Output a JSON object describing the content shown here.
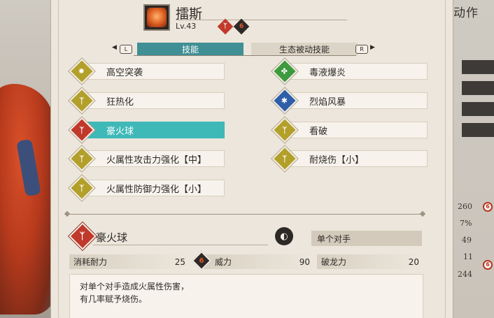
{
  "header": {
    "monster_name": "擂斯",
    "level": "Lv.43",
    "type_icons": [
      {
        "name": "claw-type-icon",
        "glyph": "ᛉ",
        "bg": "#c0392b",
        "fg": "#ffffff"
      },
      {
        "name": "fire-element-icon",
        "glyph": "6",
        "bg": "#2d2926",
        "fg": "#e25a2a"
      }
    ]
  },
  "tabs": {
    "left_key": "L",
    "right_key": "R",
    "items": [
      {
        "label": "技能",
        "active": true
      },
      {
        "label": "生态被动技能",
        "active": false
      }
    ]
  },
  "skills": {
    "left": [
      {
        "label": "高空突袭",
        "icon": "sun-burst-icon",
        "icon_color": "#b3a02a",
        "glyph": "✹",
        "selected": false
      },
      {
        "label": "狂热化",
        "icon": "power-fist-icon",
        "icon_color": "#b3a02a",
        "glyph": "ᛉ",
        "selected": false
      },
      {
        "label": "豪火球",
        "icon": "power-fist-icon",
        "icon_color": "#c0392b",
        "glyph": "ᛉ",
        "selected": true
      },
      {
        "label": "火属性攻击力强化【中】",
        "icon": "power-fist-icon",
        "icon_color": "#b3a02a",
        "glyph": "ᛉ",
        "selected": false
      },
      {
        "label": "火属性防御力强化【小】",
        "icon": "power-fist-icon",
        "icon_color": "#b3a02a",
        "glyph": "ᛉ",
        "selected": false
      }
    ],
    "right": [
      {
        "label": "毒液爆炎",
        "icon": "venom-clover-icon",
        "icon_color": "#3e9a3e",
        "glyph": "✤",
        "selected": false
      },
      {
        "label": "烈焰风暴",
        "icon": "storm-swirl-icon",
        "icon_color": "#2e5fa8",
        "glyph": "✱",
        "selected": false
      },
      {
        "label": "看破",
        "icon": "power-fist-icon",
        "icon_color": "#b3a02a",
        "glyph": "ᛉ",
        "selected": false
      },
      {
        "label": "耐烧伤【小】",
        "icon": "power-fist-icon",
        "icon_color": "#b3a02a",
        "glyph": "ᛉ",
        "selected": false
      }
    ]
  },
  "detail": {
    "name": "豪火球",
    "target": "单个对手",
    "stamina_label": "消耗耐力",
    "stamina_value": "25",
    "power_label": "威力",
    "power_value": "90",
    "kinship_label": "破龙力",
    "kinship_value": "20",
    "description_line1": "对单个对手造成火属性伤害，",
    "description_line2": "有几率赋予烧伤。"
  },
  "background": {
    "right_title": "动作",
    "stats": [
      "260",
      "7%",
      "49",
      "11",
      "244"
    ]
  }
}
